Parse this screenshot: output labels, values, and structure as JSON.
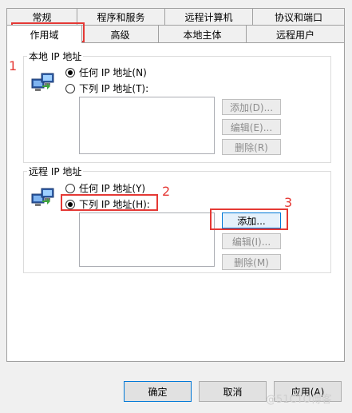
{
  "tabs_row1": [
    "常规",
    "程序和服务",
    "远程计算机",
    "协议和端口"
  ],
  "tabs_row2": [
    "作用域",
    "高级",
    "本地主体",
    "远程用户"
  ],
  "local": {
    "title": "本地 IP 地址",
    "any": "任何 IP 地址(N)",
    "list": "下列 IP 地址(T):",
    "add": "添加(D)...",
    "edit": "编辑(E)...",
    "delete": "删除(R)"
  },
  "remote": {
    "title": "远程 IP 地址",
    "any": "任何 IP 地址(Y)",
    "list": "下列 IP 地址(H):",
    "add": "添加...",
    "edit": "编辑(I)...",
    "delete": "删除(M)"
  },
  "annotations": [
    "1",
    "2",
    "3"
  ],
  "buttons": {
    "ok": "确定",
    "cancel": "取消",
    "apply": "应用(A)"
  },
  "watermark": "@51CTO博客",
  "colors": {
    "annotation": "#e53935",
    "focus": "#0078d7"
  }
}
